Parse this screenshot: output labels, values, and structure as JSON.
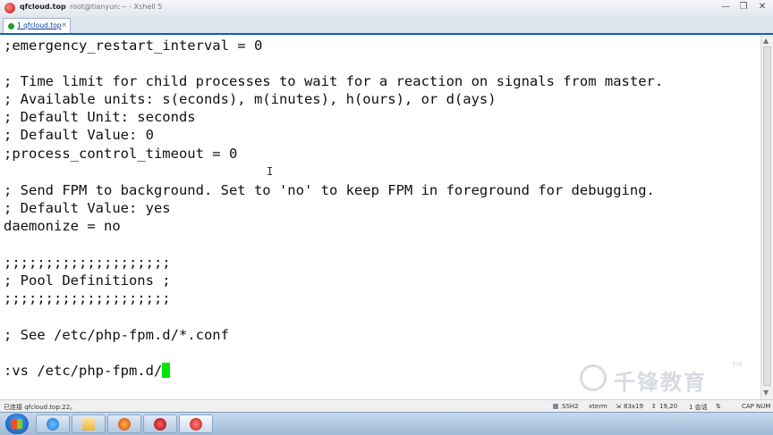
{
  "window": {
    "host": "qfcloud.top",
    "full_title": "root@tianyun:~ - Xshell 5",
    "controls": {
      "minimize": "—",
      "restore": "❐",
      "close": "✕"
    }
  },
  "tabs": [
    {
      "label": "1 qfcloud.top",
      "close": "×"
    }
  ],
  "tab_add": "+",
  "terminal": {
    "lines": [
      ";emergency_restart_interval = 0",
      "",
      "; Time limit for child processes to wait for a reaction on signals from master.",
      "; Available units: s(econds), m(inutes), h(ours), or d(ays)",
      "; Default Unit: seconds",
      "; Default Value: 0",
      ";process_control_timeout = 0",
      "",
      "; Send FPM to background. Set to 'no' to keep FPM in foreground for debugging.",
      "; Default Value: yes",
      "daemonize = no",
      "",
      ";;;;;;;;;;;;;;;;;;;;",
      "; Pool Definitions ;",
      ";;;;;;;;;;;;;;;;;;;;",
      "",
      "; See /etc/php-fpm.d/*.conf",
      "",
      ":vs /etc/php-fpm.d/"
    ],
    "cursor_color": "#00e600",
    "ibeam": "I"
  },
  "watermark": {
    "text": "千锋教育",
    "tm": "TM"
  },
  "statusbar": {
    "connection": "已连接 qfcloud.top:22。",
    "protocol": "SSH2",
    "terminal_type": "xterm",
    "size": "83x19",
    "position": "19,20",
    "sessions": "1 会话",
    "caps": "CAP",
    "num": "NUM"
  },
  "taskbar": {
    "icons": [
      "windows-start-icon",
      "ie-icon",
      "file-explorer-icon",
      "firefox-icon",
      "cherry-icon",
      "xshell-icon"
    ]
  }
}
